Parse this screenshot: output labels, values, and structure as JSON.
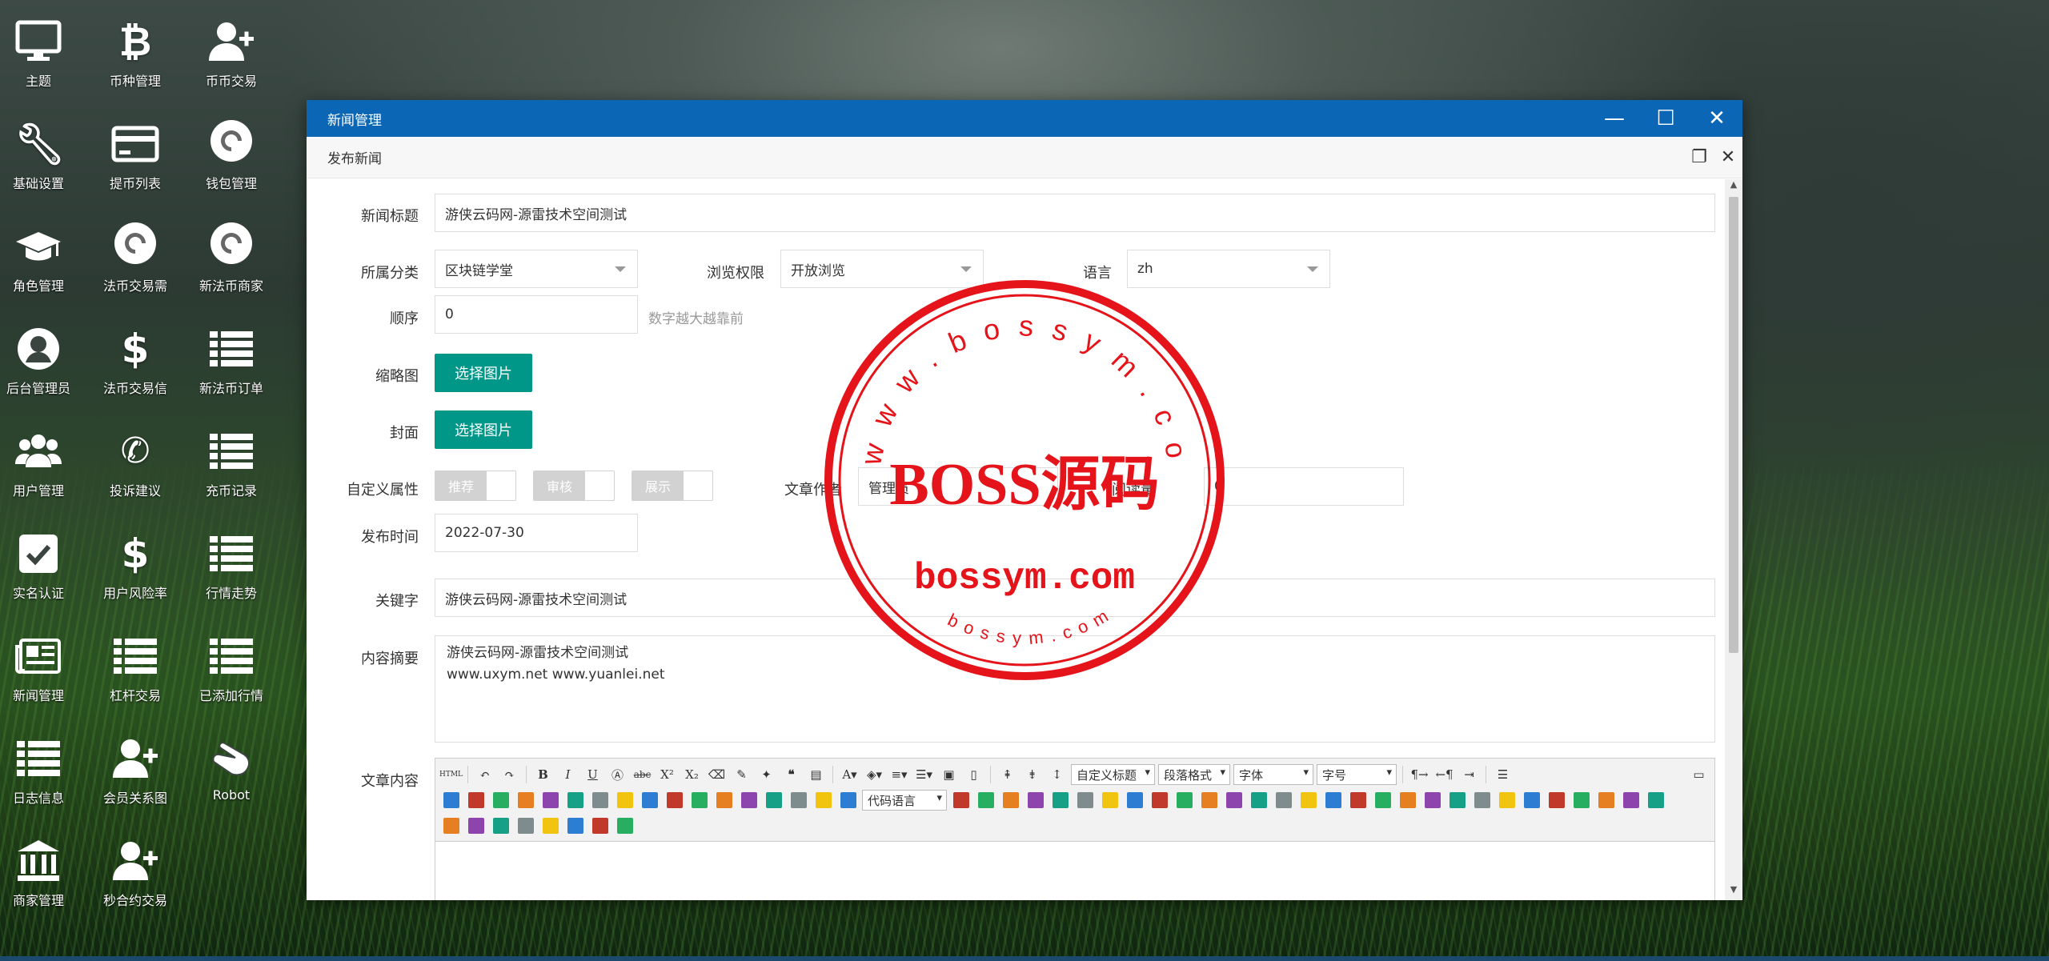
{
  "desktop": {
    "icons": [
      {
        "label": "主题",
        "icon": "monitor-icon"
      },
      {
        "label": "币种管理",
        "icon": "bitcoin-icon"
      },
      {
        "label": "币币交易",
        "icon": "user-plus-icon"
      },
      {
        "label": "基础设置",
        "icon": "wrench-icon"
      },
      {
        "label": "提币列表",
        "icon": "credit-card-icon"
      },
      {
        "label": "钱包管理",
        "icon": "link-icon"
      },
      {
        "label": "角色管理",
        "icon": "graduation-cap-icon"
      },
      {
        "label": "法币交易需",
        "icon": "link-icon"
      },
      {
        "label": "新法币商家",
        "icon": "link-icon"
      },
      {
        "label": "后台管理员",
        "icon": "user-circle-icon"
      },
      {
        "label": "法币交易信",
        "icon": "dollar-icon"
      },
      {
        "label": "新法币订单",
        "icon": "list-icon"
      },
      {
        "label": "用户管理",
        "icon": "users-icon"
      },
      {
        "label": "投诉建议",
        "icon": "phone-icon"
      },
      {
        "label": "充币记录",
        "icon": "list-icon"
      },
      {
        "label": "实名认证",
        "icon": "check-square-icon"
      },
      {
        "label": "用户风险率",
        "icon": "dollar-icon"
      },
      {
        "label": "行情走势",
        "icon": "list-icon"
      },
      {
        "label": "新闻管理",
        "icon": "newspaper-icon"
      },
      {
        "label": "杠杆交易",
        "icon": "list-icon"
      },
      {
        "label": "已添加行情",
        "icon": "list-icon"
      },
      {
        "label": "日志信息",
        "icon": "list-icon"
      },
      {
        "label": "会员关系图",
        "icon": "user-plus-icon"
      },
      {
        "label": "Robot",
        "icon": "hand-icon"
      },
      {
        "label": "商家管理",
        "icon": "bank-icon"
      },
      {
        "label": "秒合约交易",
        "icon": "user-plus-icon"
      }
    ]
  },
  "window": {
    "title": "新闻管理",
    "subtitle": "发布新闻"
  },
  "form": {
    "title_label": "新闻标题",
    "title_value": "游侠云码网-源雷技术空间测试",
    "category_label": "所属分类",
    "category_value": "区块链学堂",
    "permission_label": "浏览权限",
    "permission_value": "开放浏览",
    "language_label": "语言",
    "language_value": "zh",
    "order_label": "顺序",
    "order_value": "0",
    "order_hint": "数字越大越靠前",
    "thumb_label": "缩略图",
    "thumb_button": "选择图片",
    "cover_label": "封面",
    "cover_button": "选择图片",
    "attr_label": "自定义属性",
    "attr_recommend": "推荐",
    "attr_review": "审核",
    "attr_show": "展示",
    "author_label": "文章作者",
    "author_value": "管理员",
    "views_label": "阅读量",
    "views_value": "0",
    "date_label": "发布时间",
    "date_value": "2022-07-30",
    "keywords_label": "关键字",
    "keywords_value": "游侠云码网-源雷技术空间测试",
    "summary_label": "内容摘要",
    "summary_value": "游侠云码网-源雷技术空间测试\nwww.uxym.net  www.yuanlei.net",
    "content_label": "文章内容"
  },
  "editor": {
    "custom_title": "自定义标题",
    "paragraph": "段落格式",
    "font": "字体",
    "font_size": "字号",
    "code_lang": "代码语言"
  },
  "stamp": {
    "top_text": "www.bossym.com",
    "main_text": "BOSS源码",
    "domain_text": "bossym.com",
    "bottom_text": "bossym.com",
    "color": "#e5141b"
  }
}
